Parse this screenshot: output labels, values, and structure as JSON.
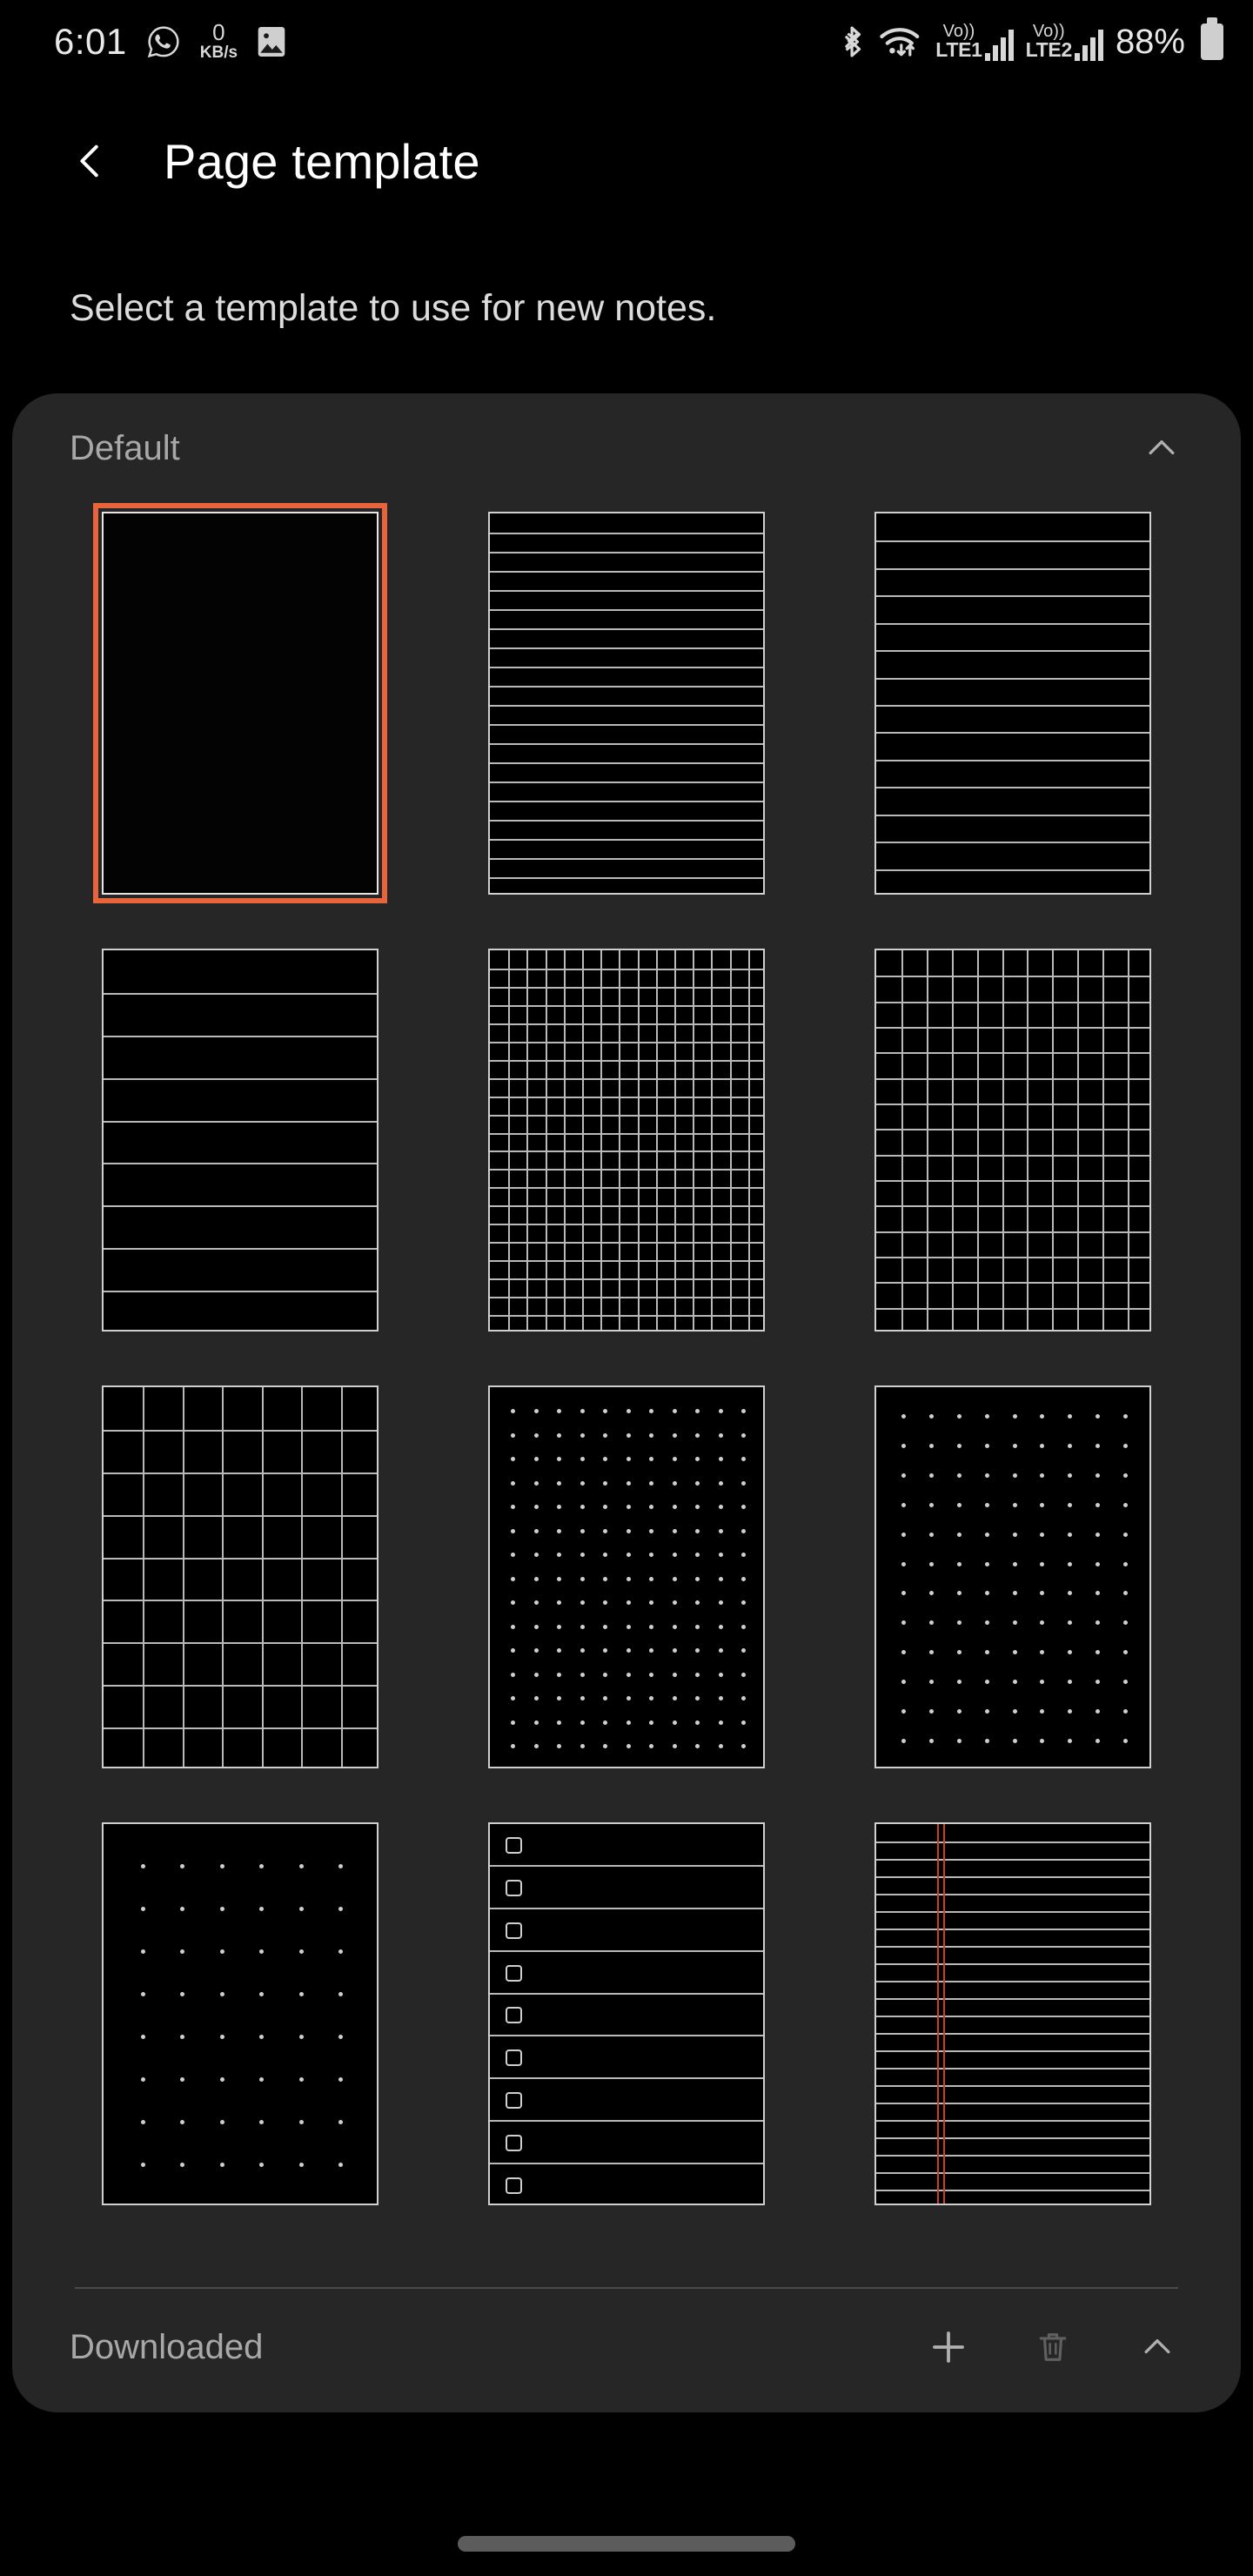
{
  "status_bar": {
    "time": "6:01",
    "whatsapp_icon": "whatsapp-icon",
    "network_speed_value": "0",
    "network_speed_unit": "KB/s",
    "gallery_icon": "gallery-image-icon",
    "bluetooth_icon": "bluetooth-icon",
    "wifi_icon": "wifi-data-transfer-icon",
    "sim1": {
      "volte_label": "Vo))",
      "network_label": "LTE1"
    },
    "sim2": {
      "volte_label": "Vo))",
      "network_label": "LTE2"
    },
    "battery_percent": "88%",
    "battery_icon": "battery-full-icon"
  },
  "header": {
    "back_icon": "back-chevron-icon",
    "title": "Page template"
  },
  "subtitle": "Select a template to use for new notes.",
  "sections": {
    "default": {
      "title": "Default",
      "collapse_icon": "chevron-up-icon",
      "expanded": true,
      "templates": [
        {
          "id": "blank",
          "name": "blank-template",
          "pattern": "blank",
          "selected": true
        },
        {
          "id": "lines-narrow",
          "name": "narrow-ruled-template",
          "pattern": "lines",
          "rows": 20,
          "selected": false
        },
        {
          "id": "lines-medium",
          "name": "medium-ruled-template",
          "pattern": "lines",
          "rows": 14,
          "selected": false
        },
        {
          "id": "lines-wide",
          "name": "wide-ruled-template",
          "pattern": "lines",
          "rows": 9,
          "selected": false
        },
        {
          "id": "grid-small",
          "name": "small-grid-template",
          "pattern": "grid",
          "cols": 15,
          "rows": 21,
          "selected": false
        },
        {
          "id": "grid-medium",
          "name": "medium-grid-template",
          "pattern": "grid",
          "cols": 11,
          "rows": 15,
          "selected": false
        },
        {
          "id": "grid-large",
          "name": "large-grid-template",
          "pattern": "grid",
          "cols": 7,
          "rows": 9,
          "selected": false
        },
        {
          "id": "dots-small",
          "name": "small-dot-grid-template",
          "pattern": "dots",
          "cols": 11,
          "rows": 15,
          "selected": false
        },
        {
          "id": "dots-medium",
          "name": "medium-dot-grid-template",
          "pattern": "dots",
          "cols": 9,
          "rows": 12,
          "selected": false
        },
        {
          "id": "dots-large",
          "name": "large-dot-grid-template",
          "pattern": "dots",
          "cols": 6,
          "rows": 8,
          "selected": false
        },
        {
          "id": "checklist",
          "name": "checklist-template",
          "pattern": "checklist",
          "rows": 9,
          "selected": false
        },
        {
          "id": "lines-margin",
          "name": "ruled-with-margin-template",
          "pattern": "lines-margin",
          "rows": 22,
          "margin_pct": 22,
          "selected": false
        }
      ]
    },
    "downloaded": {
      "title": "Downloaded",
      "add_icon": "plus-icon",
      "delete_icon": "trash-icon",
      "delete_enabled": false,
      "collapse_icon": "chevron-up-icon"
    }
  },
  "colors": {
    "selection_accent": "#e8643c",
    "card_background": "#262626",
    "page_background": "#000000",
    "template_stroke": "#b9b9b9",
    "margin_rule": "#c8402c",
    "secondary_text": "#a8a8a8"
  },
  "navigation": {
    "home_indicator": "home-indicator-pill"
  }
}
